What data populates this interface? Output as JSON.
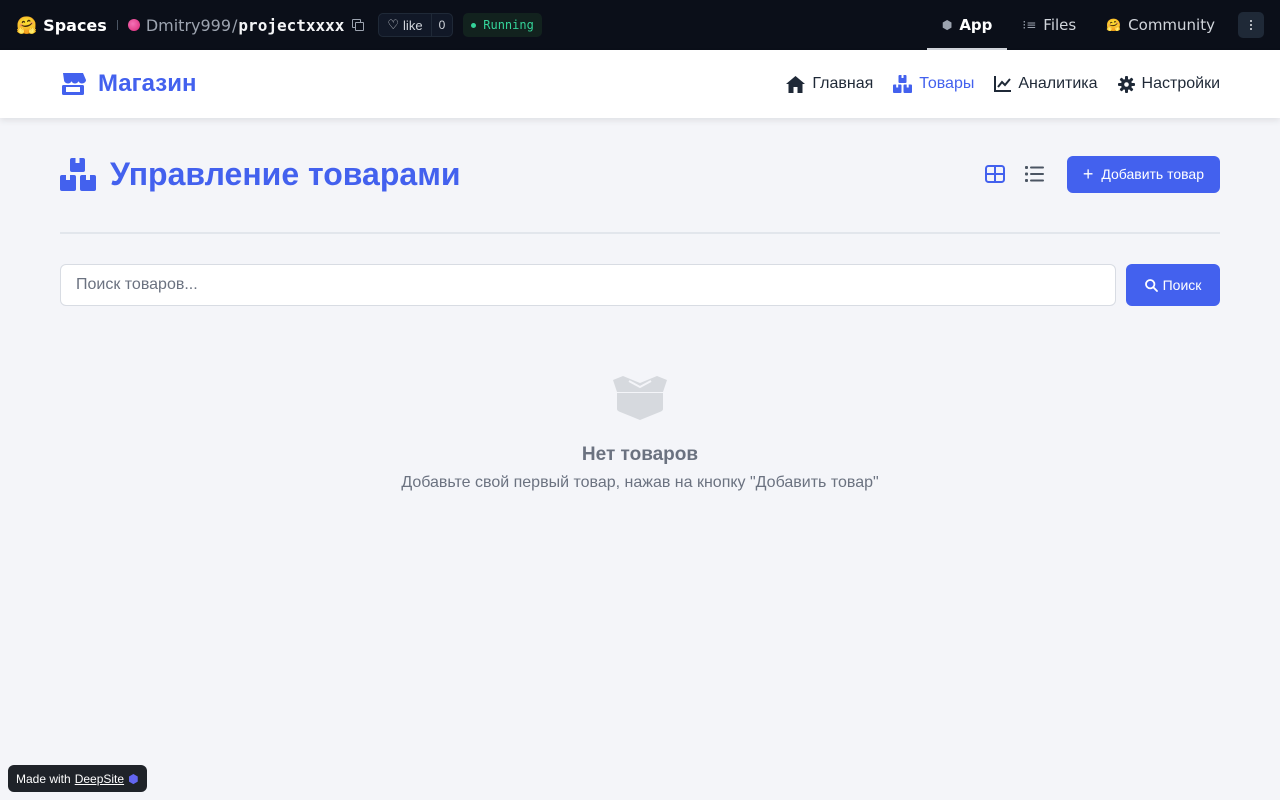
{
  "hf": {
    "logo_emoji": "🤗",
    "spaces_label": "Spaces",
    "user": "Dmitry999",
    "slash": "/",
    "repo": "projectxxxx",
    "like_label": "like",
    "like_count": "0",
    "status": "Running",
    "tabs": [
      {
        "label": "App",
        "icon": "cube-icon",
        "glyph": "⬢",
        "active": true
      },
      {
        "label": "Files",
        "icon": "files-icon",
        "glyph": "⁝≡",
        "active": false
      },
      {
        "label": "Community",
        "icon": "community-icon",
        "glyph": "🤗",
        "active": false
      }
    ]
  },
  "navbar": {
    "brand": "Магазин",
    "items": [
      {
        "label": "Главная",
        "icon": "home-icon"
      },
      {
        "label": "Товары",
        "icon": "boxes-icon",
        "active": true
      },
      {
        "label": "Аналитика",
        "icon": "chart-line-icon"
      },
      {
        "label": "Настройки",
        "icon": "gear-icon"
      }
    ]
  },
  "page": {
    "title": "Управление товарами",
    "add_button": "Добавить товар",
    "search": {
      "placeholder": "Поиск товаров...",
      "value": "",
      "button": "Поиск"
    },
    "empty": {
      "title": "Нет товаров",
      "subtitle": "Добавьте свой первый товар, нажав на кнопку \"Добавить товар\""
    }
  },
  "badge": {
    "prefix": "Made with",
    "link": "DeepSite"
  },
  "colors": {
    "accent": "#4361ee",
    "background": "#f4f5f9",
    "topbar": "#0b0f19",
    "status": "#34d399"
  }
}
